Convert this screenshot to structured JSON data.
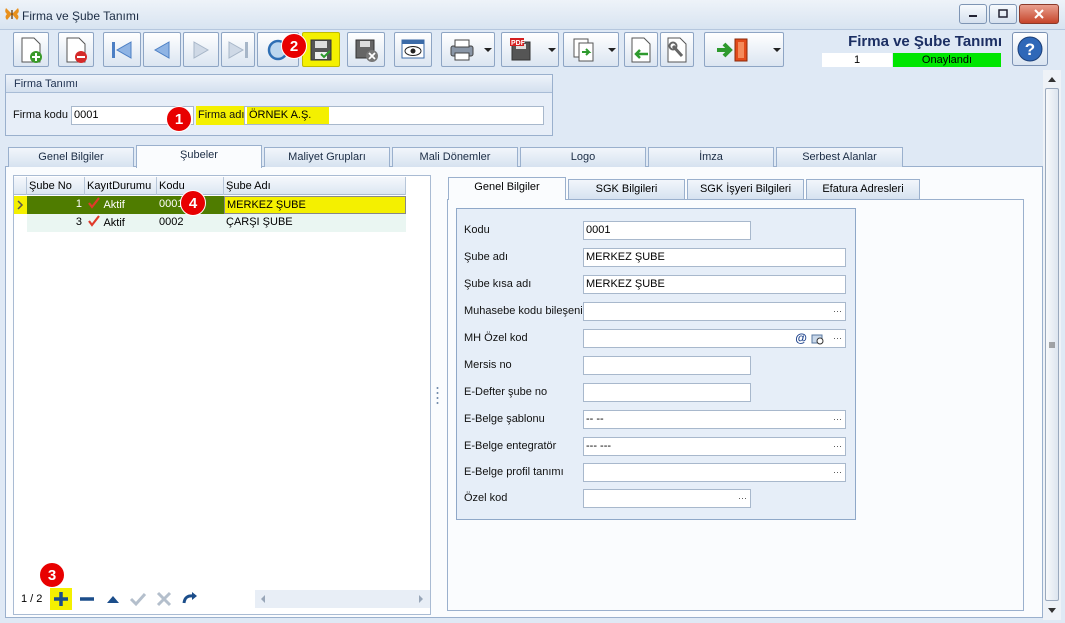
{
  "window": {
    "title": "Firma ve Şube Tanımı",
    "icon": "butterfly-icon"
  },
  "header": {
    "title": "Firma ve Şube Tanımı",
    "record_count": "1",
    "status": "Onaylandı",
    "status_color": "#00e600"
  },
  "toolbar": {
    "buttons": [
      "new-document-icon",
      "delete-document-icon",
      "first-record-icon",
      "previous-record-icon",
      "next-record-icon",
      "last-record-icon",
      "refresh-icon",
      "save-icon",
      "save-close-icon",
      "preview-icon",
      "print-icon",
      "pdf-export-icon",
      "copy-icon",
      "import-icon",
      "tools-icon",
      "exit-icon"
    ],
    "highlight_color": "#f4f000"
  },
  "firma": {
    "panel_title": "Firma Tanımı",
    "code_label": "Firma kodu",
    "code_value": "0001",
    "name_label": "Firma adı",
    "name_value": "ÖRNEK A.Ş."
  },
  "main_tabs": [
    {
      "label": "Genel Bilgiler"
    },
    {
      "label": "Şubeler"
    },
    {
      "label": "Maliyet Grupları"
    },
    {
      "label": "Mali Dönemler"
    },
    {
      "label": "Logo"
    },
    {
      "label": "İmza"
    },
    {
      "label": "Serbest Alanlar"
    }
  ],
  "grid": {
    "columns": [
      "Şube No",
      "KayıtDurumu",
      "Kodu",
      "Şube Adı"
    ],
    "rows": [
      {
        "no": "1",
        "status": "Aktif",
        "code": "0001",
        "name": "MERKEZ ŞUBE"
      },
      {
        "no": "3",
        "status": "Aktif",
        "code": "0002",
        "name": "ÇARŞI ŞUBE"
      }
    ],
    "nav_count": "1 / 2"
  },
  "right_tabs": [
    {
      "label": "Genel Bilgiler"
    },
    {
      "label": "SGK Bilgileri"
    },
    {
      "label": "SGK İşyeri Bilgileri"
    },
    {
      "label": "Efatura Adresleri"
    }
  ],
  "form": {
    "kodu_label": "Kodu",
    "kodu_value": "0001",
    "sube_adi_label": "Şube adı",
    "sube_adi_value": "MERKEZ ŞUBE",
    "sube_kisa_label": "Şube kısa adı",
    "sube_kisa_value": "MERKEZ ŞUBE",
    "muhasebe_label": "Muhasebe kodu bileşeni",
    "muhasebe_value": "",
    "mh_ozel_label": "MH Özel kod",
    "mh_ozel_value": "",
    "mersis_label": "Mersis no",
    "mersis_value": "",
    "edefter_label": "E-Defter şube no",
    "edefter_value": "",
    "ebelge_sablon_label": "E-Belge şablonu",
    "ebelge_sablon_value": "-- --",
    "ebelge_entegrator_label": "E-Belge entegratör",
    "ebelge_entegrator_value": "--- ---",
    "ebelge_profil_label": "E-Belge profil tanımı",
    "ebelge_profil_value": "",
    "ozel_kod_label": "Özel kod",
    "ozel_kod_value": "",
    "ellipsis": "···",
    "at_sign": "@"
  },
  "badges": [
    "1",
    "2",
    "3",
    "4"
  ]
}
